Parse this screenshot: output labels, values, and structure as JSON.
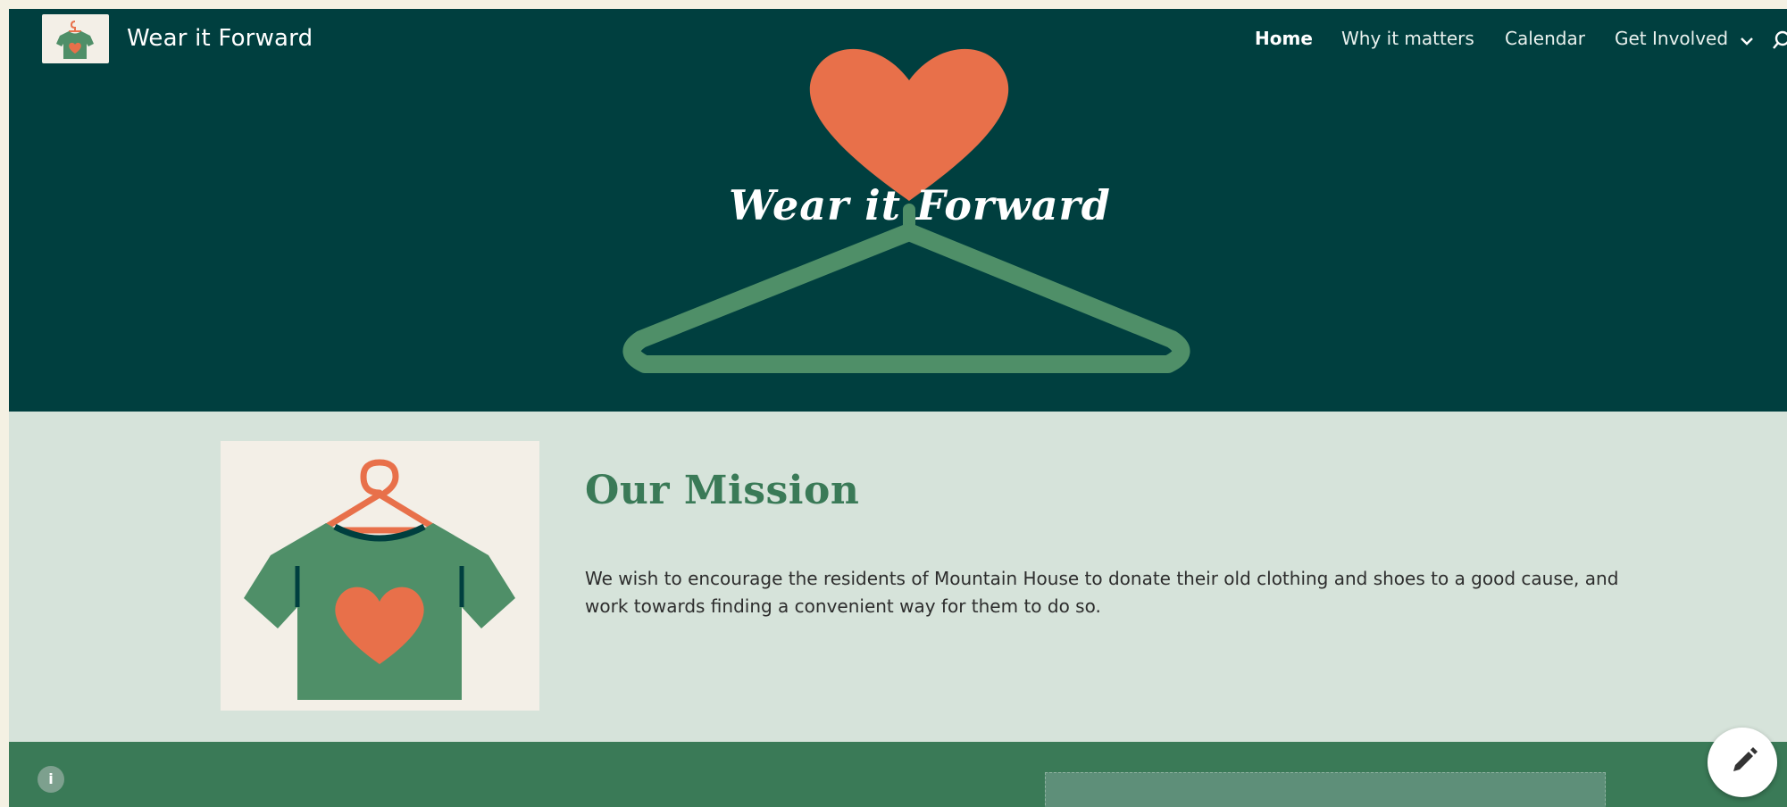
{
  "header": {
    "site_title": "Wear it Forward",
    "nav": [
      {
        "label": "Home",
        "active": true
      },
      {
        "label": "Why it matters",
        "active": false
      },
      {
        "label": "Calendar",
        "active": false
      },
      {
        "label": "Get Involved",
        "active": false,
        "has_dropdown": true
      }
    ],
    "search_icon": "search-icon"
  },
  "hero": {
    "title": "Wear it Forward"
  },
  "mission": {
    "heading": "Our Mission",
    "body": "We wish to encourage the residents of Mountain House to donate their old clothing and shoes to a good cause, and work towards finding a convenient way for them to do so."
  },
  "bottom": {
    "info_icon": "info-icon",
    "edit_icon": "pencil-icon"
  },
  "colors": {
    "hero_bg": "#003f3f",
    "accent_orange": "#e8704a",
    "green": "#4f8f68",
    "mission_bg": "#d6e3da",
    "bottom_bg": "#3a7a57"
  }
}
